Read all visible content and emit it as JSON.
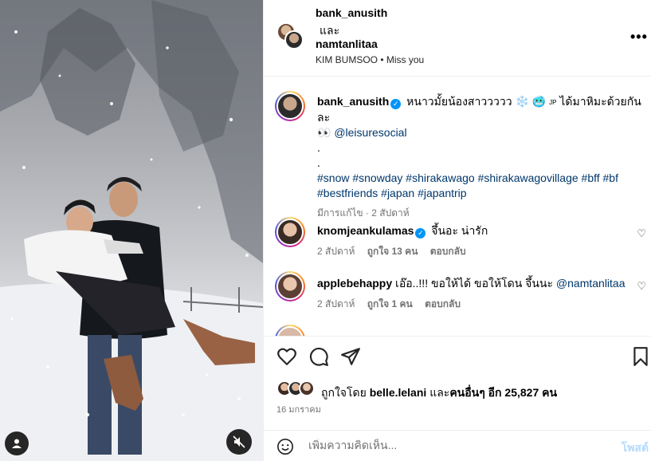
{
  "header": {
    "author1": "bank_anusith",
    "and_text": "และ",
    "author2": "namtanlitaa",
    "audio": "KIM BUMSOO • Miss you",
    "more_icon": "more-horizontal-icon"
  },
  "caption": {
    "username": "bank_anusith",
    "text1": "หนาวมั้ยน้องสาววววว ❄️ 🥶",
    "flag": "JP",
    "text2": "ได้มาหิมะด้วยกันละ",
    "eyes": "👀",
    "mention": "@leisuresocial",
    "dot1": ".",
    "dot2": ".",
    "hashtags1": "#snow #snowday #shirakawago #shirakawagovillage #bff #bf",
    "hashtags2": "#bestfriends #japan #japantrip",
    "meta": "มีการแก้ไข · 2 สัปดาห์"
  },
  "comments": [
    {
      "username": "knomjeankulamas",
      "text": "จึ้นอะ น่ารัก",
      "age": "2 สัปดาห์",
      "likes": "ถูกใจ 13 คน",
      "reply": "ตอบกลับ"
    },
    {
      "username": "applebehappy",
      "text": "เอ๊อ..!!! ขอให้ได้ ขอให้โดน จึ้นนะ",
      "mention": "@namtanlitaa",
      "age": "2 สัปดาห์",
      "likes": "ถูกใจ 1 คน",
      "reply": "ตอบกลับ"
    }
  ],
  "likes": {
    "prefix": "ถูกใจโดย",
    "user": "belle.lelani",
    "middle": "และ",
    "others": "คนอื่นๆ อีก 25,827 คน"
  },
  "date": "16 มกราคม",
  "add_comment": {
    "placeholder": "เพิ่มความคิดเห็น...",
    "post_label": "โพสต์"
  },
  "colors": {
    "verified": "#0095f6",
    "link": "#00376b",
    "post_disabled": "#b3dbff"
  }
}
